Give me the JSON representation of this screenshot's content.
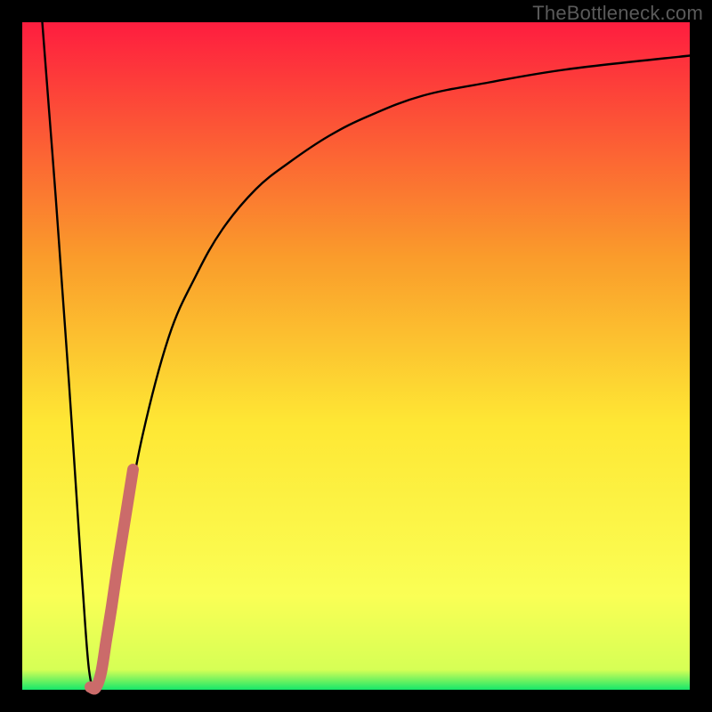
{
  "watermark": "TheBottleneck.com",
  "chart_data": {
    "type": "line",
    "title": "",
    "xlabel": "",
    "ylabel": "",
    "xlim": [
      0,
      100
    ],
    "ylim": [
      0,
      100
    ],
    "gradient_colors": {
      "top": "#fe1d3f",
      "mid_upper": "#fa9b2b",
      "mid": "#fee734",
      "lower": "#faff55",
      "base": "#16e76a"
    },
    "series": [
      {
        "name": "bottleneck-curve",
        "color": "#000000",
        "x": [
          3,
          4,
          5,
          6,
          7,
          8,
          9,
          10,
          11,
          12,
          13,
          15,
          18,
          22,
          26,
          30,
          35,
          40,
          46,
          52,
          60,
          70,
          82,
          100
        ],
        "y": [
          100,
          87,
          74,
          60,
          46,
          31,
          16,
          3,
          0,
          3,
          10,
          22,
          38,
          53,
          62,
          69,
          75,
          79,
          83,
          86,
          89,
          91,
          93,
          95
        ]
      },
      {
        "name": "highlight-segment",
        "color": "#cb6b6a",
        "x": [
          10.2,
          11.0,
          11.8,
          12.6,
          13.4,
          14.2,
          15.0,
          15.8,
          16.6
        ],
        "y": [
          0.4,
          0.3,
          2.5,
          7.5,
          12.5,
          18.0,
          23.0,
          28.0,
          33.0
        ]
      }
    ]
  }
}
